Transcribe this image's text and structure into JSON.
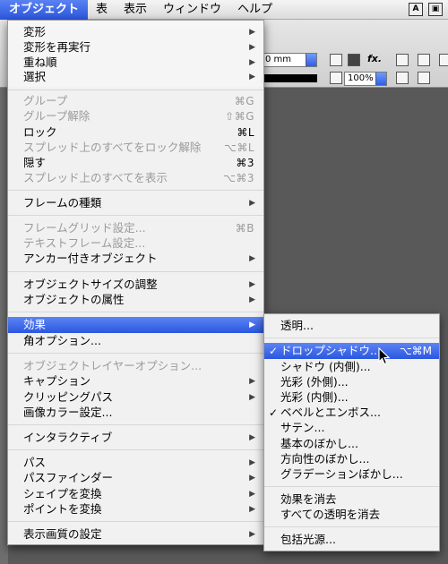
{
  "menubar": {
    "items": [
      "オブジェクト",
      "表",
      "表示",
      "ウィンドウ",
      "ヘルプ"
    ],
    "status_icons": [
      "a-icon",
      "screen-icon"
    ]
  },
  "toolbar": {
    "field_value": "0 mm",
    "zoom_value": "100%"
  },
  "object_menu": {
    "items": [
      {
        "label": "変形",
        "arrow": true,
        "enabled": true
      },
      {
        "label": "変形を再実行",
        "arrow": true,
        "enabled": true
      },
      {
        "label": "重ね順",
        "arrow": true,
        "enabled": true
      },
      {
        "label": "選択",
        "arrow": true,
        "enabled": true
      },
      {
        "label": "グループ",
        "shortcut": "⌘G",
        "enabled": false
      },
      {
        "label": "グループ解除",
        "shortcut": "⇧⌘G",
        "enabled": false
      },
      {
        "label": "ロック",
        "shortcut": "⌘L",
        "enabled": true
      },
      {
        "label": "スプレッド上のすべてをロック解除",
        "shortcut": "⌥⌘L",
        "enabled": false
      },
      {
        "label": "隠す",
        "shortcut": "⌘3",
        "enabled": true
      },
      {
        "label": "スプレッド上のすべてを表示",
        "shortcut": "⌥⌘3",
        "enabled": false
      },
      {
        "label": "フレームの種類",
        "arrow": true,
        "enabled": true
      },
      {
        "label": "フレームグリッド設定...",
        "shortcut": "⌘B",
        "enabled": false
      },
      {
        "label": "テキストフレーム設定...",
        "enabled": false
      },
      {
        "label": "アンカー付きオブジェクト",
        "arrow": true,
        "enabled": true
      },
      {
        "label": "オブジェクトサイズの調整",
        "arrow": true,
        "enabled": true
      },
      {
        "label": "オブジェクトの属性",
        "arrow": true,
        "enabled": true
      },
      {
        "label": "効果",
        "arrow": true,
        "enabled": true,
        "highlight": true
      },
      {
        "label": "角オプション...",
        "enabled": true
      },
      {
        "label": "オブジェクトレイヤーオプション...",
        "enabled": false
      },
      {
        "label": "キャプション",
        "arrow": true,
        "enabled": true
      },
      {
        "label": "クリッピングパス",
        "arrow": true,
        "enabled": true
      },
      {
        "label": "画像カラー設定...",
        "enabled": true
      },
      {
        "label": "インタラクティブ",
        "arrow": true,
        "enabled": true
      },
      {
        "label": "パス",
        "arrow": true,
        "enabled": true
      },
      {
        "label": "パスファインダー",
        "arrow": true,
        "enabled": true
      },
      {
        "label": "シェイプを変換",
        "arrow": true,
        "enabled": true
      },
      {
        "label": "ポイントを変換",
        "arrow": true,
        "enabled": true
      },
      {
        "label": "表示画質の設定",
        "arrow": true,
        "enabled": true
      }
    ]
  },
  "effects_submenu": {
    "items": [
      {
        "label": "透明...",
        "checked": false
      },
      {
        "label": "ドロップシャドウ...",
        "checked": true,
        "shortcut": "⌥⌘M",
        "highlight": true
      },
      {
        "label": "シャドウ (内側)...",
        "checked": false
      },
      {
        "label": "光彩 (外側)...",
        "checked": false
      },
      {
        "label": "光彩 (内側)...",
        "checked": false
      },
      {
        "label": "ベベルとエンボス...",
        "checked": true
      },
      {
        "label": "サテン...",
        "checked": false
      },
      {
        "label": "基本のぼかし...",
        "checked": false
      },
      {
        "label": "方向性のぼかし...",
        "checked": false
      },
      {
        "label": "グラデーションぼかし...",
        "checked": false
      },
      {
        "label": "効果を消去",
        "checked": false
      },
      {
        "label": "すべての透明を消去",
        "checked": false
      },
      {
        "label": "包括光源...",
        "checked": false
      }
    ],
    "check_mark": "✓"
  }
}
